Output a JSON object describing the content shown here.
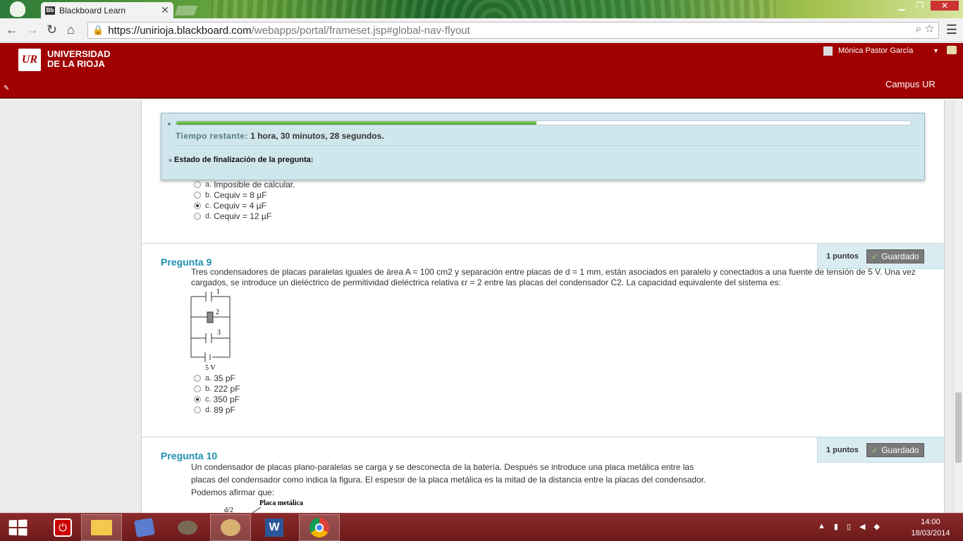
{
  "browser": {
    "tab_title": "Blackboard Learn",
    "tab_favicon": "Bb",
    "url_host": "https://unirioja.blackboard.com",
    "url_path": "/webapps/portal/frameset.jsp#global-nav-flyout"
  },
  "header": {
    "logo_text": "UR",
    "university_line1": "UNIVERSIDAD",
    "university_line2": "DE LA RIOJA",
    "user_name": "Mónica Pastor García",
    "campus_link": "Campus UR"
  },
  "timer": {
    "label": "Tiempo restante:",
    "value": "1 hora, 30 minutos, 28 segundos.",
    "progress_fraction": 0.49,
    "status_label": "Estado de finalización de la pregunta:"
  },
  "question8": {
    "options": [
      {
        "letter": "a.",
        "text": "Imposible de calcular.",
        "selected": false
      },
      {
        "letter": "b.",
        "text": "Cequiv = 8 µF",
        "selected": false
      },
      {
        "letter": "c.",
        "text": "Cequiv = 4 µF",
        "selected": true
      },
      {
        "letter": "d.",
        "text": "Cequiv = 12 µF",
        "selected": false
      }
    ]
  },
  "question9": {
    "title": "Pregunta 9",
    "points": "1 puntos",
    "saved": "Guardado",
    "text": "Tres condensadores de placas paralelas iguales de área A = 100 cm2 y separación entre placas de d = 1 mm, están asociados en paralelo y conectados a una fuente de tensión de 5 V. Una vez cargados, se introduce un dieléctrico de permitividad dieléctrica relativa εr = 2 entre las placas del condensador C2. La capacidad equivalente del sistema es:",
    "figure_labels": {
      "c1": "1",
      "c2": "2",
      "c3": "3",
      "source": "5 V"
    },
    "options": [
      {
        "letter": "a.",
        "text": "35 pF",
        "selected": false
      },
      {
        "letter": "b.",
        "text": "222 pF",
        "selected": false
      },
      {
        "letter": "c.",
        "text": "350 pF",
        "selected": true
      },
      {
        "letter": "d.",
        "text": "89 pF",
        "selected": false
      }
    ]
  },
  "question10": {
    "title": "Pregunta 10",
    "points": "1 puntos",
    "saved": "Guardado",
    "line1": "Un condensador de placas plano-paralelas se carga y se desconecta de la batería. Después se introduce una placa metálica entre las",
    "line2": "placas del condensador como indica la figura. El espesor de la placa metálica es la mitad de la distancia entre la placas del condensador.",
    "line3": "Podemos afirmar que:",
    "figure_label_d2": "d/2",
    "figure_label_plate": "Placa metálica"
  },
  "taskbar": {
    "time": "14:00",
    "date": "18/03/2014"
  }
}
